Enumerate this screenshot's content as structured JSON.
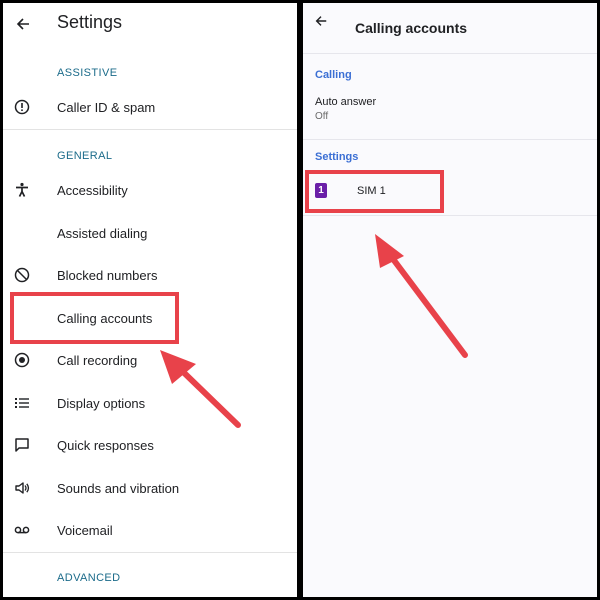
{
  "settings": {
    "title": "Settings",
    "sections": [
      {
        "label": "ASSISTIVE",
        "items": [
          {
            "label": "Caller ID & spam",
            "icon": "info-circle-icon"
          }
        ]
      },
      {
        "label": "GENERAL",
        "items": [
          {
            "label": "Accessibility",
            "icon": "accessibility-icon"
          },
          {
            "label": "Assisted dialing",
            "icon": ""
          },
          {
            "label": "Blocked numbers",
            "icon": "block-icon"
          },
          {
            "label": "Calling accounts",
            "icon": ""
          },
          {
            "label": "Call recording",
            "icon": "record-icon"
          },
          {
            "label": "Display options",
            "icon": "list-icon"
          },
          {
            "label": "Quick responses",
            "icon": "message-icon"
          },
          {
            "label": "Sounds and vibration",
            "icon": "volume-icon"
          },
          {
            "label": "Voicemail",
            "icon": "voicemail-icon"
          }
        ]
      },
      {
        "label": "ADVANCED",
        "items": []
      }
    ]
  },
  "calling_accounts": {
    "title": "Calling accounts",
    "calling_section": "Calling",
    "auto_answer": {
      "title": "Auto answer",
      "value": "Off"
    },
    "settings_section": "Settings",
    "sim": {
      "badge": "1",
      "label": "SIM 1"
    }
  },
  "colors": {
    "highlight": "#e8424a",
    "section_teal": "#1b6b8a",
    "section_blue": "#3b6fd4",
    "sim_badge": "#6a1fa8"
  }
}
